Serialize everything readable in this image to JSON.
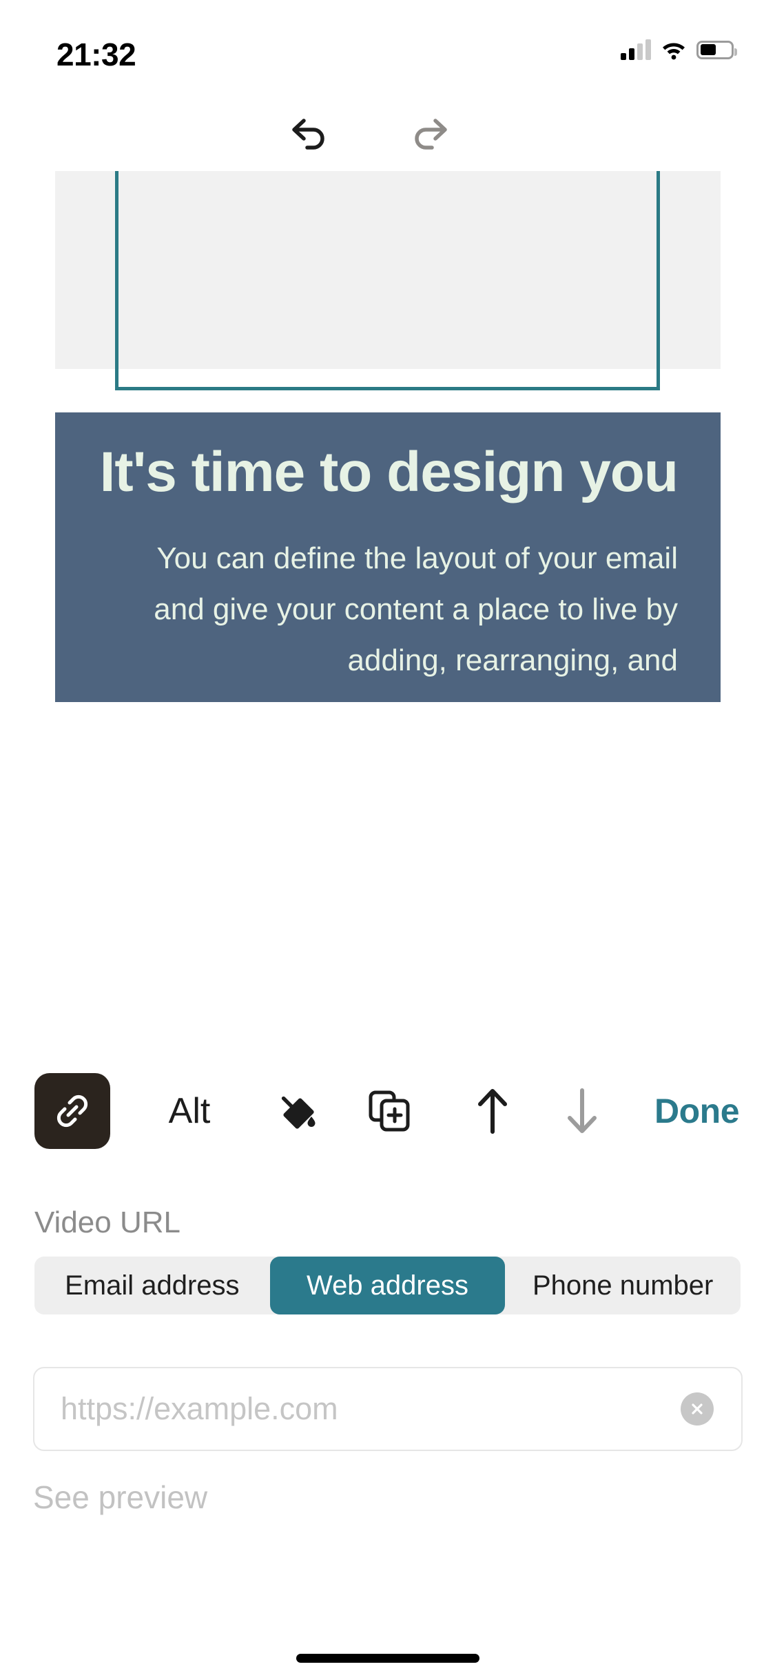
{
  "status_bar": {
    "time": "21:32",
    "signal_icon": "cellular-signal-icon",
    "signal_bars_filled": 2,
    "signal_bars_total": 4,
    "wifi_icon": "wifi-icon",
    "battery_icon": "battery-icon",
    "battery_level_percent": 52
  },
  "history_bar": {
    "undo_icon": "undo-arrow-icon",
    "redo_icon": "redo-arrow-icon",
    "undo_enabled": true,
    "redo_enabled": false
  },
  "canvas": {
    "video_block": {
      "play_icon": "play-icon",
      "selected": true,
      "selection_color": "#2b7a85",
      "placeholder_color": "#f1f1f1"
    },
    "text_block": {
      "background_color": "#4e647f",
      "text_color": "#e7f2e5",
      "headline": "It's time to design you",
      "body": "You can define the layout of your email and give your content a place to live by adding, rearranging, and"
    }
  },
  "block_toolbar": {
    "link_icon": "link-icon",
    "link_selected": true,
    "alt_label": "Alt",
    "fill_icon": "paint-bucket-icon",
    "duplicate_icon": "duplicate-icon",
    "move_up_icon": "arrow-up-icon",
    "move_down_icon": "arrow-down-icon",
    "move_up_enabled": true,
    "move_down_enabled": false,
    "done_label": "Done",
    "done_color": "#2b7a8c"
  },
  "settings_panel": {
    "field_label": "Video URL",
    "link_type_options": [
      "Email address",
      "Web address",
      "Phone number"
    ],
    "link_type_selected": "Web address",
    "url_value": "",
    "url_placeholder": "https://example.com",
    "clear_icon": "close-circle-icon",
    "preview_label": "See preview",
    "preview_enabled": false
  }
}
